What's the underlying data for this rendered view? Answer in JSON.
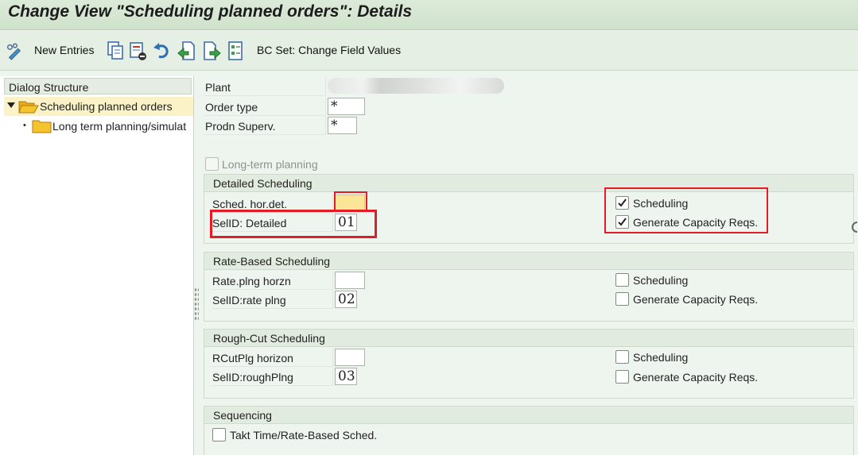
{
  "title": "Change View \"Scheduling planned orders\": Details",
  "toolbar": {
    "new_entries": "New Entries",
    "bc_set": "BC Set: Change Field Values"
  },
  "dialog_structure": {
    "title": "Dialog Structure",
    "items": [
      {
        "label": "Scheduling planned orders"
      },
      {
        "label": "Long term planning/simulat"
      }
    ]
  },
  "header_fields": {
    "plant_label": "Plant",
    "order_type_label": "Order type",
    "order_type_value": "*",
    "prodn_superv_label": "Prodn Superv.",
    "prodn_superv_value": "*"
  },
  "long_term_planning": {
    "label": "Long-term planning",
    "checked": false
  },
  "detailed": {
    "title": "Detailed Scheduling",
    "horizon_label": "Sched. hor.det.",
    "horizon_value": "",
    "selid_label": "SelID: Detailed",
    "selid_value": "01",
    "scheduling_label": "Scheduling",
    "scheduling_checked": true,
    "capacity_label": "Generate Capacity Reqs.",
    "capacity_checked": true
  },
  "rate": {
    "title": "Rate-Based Scheduling",
    "horizon_label": "Rate.plng horzn",
    "horizon_value": "",
    "selid_label": "SelID:rate plng",
    "selid_value": "02",
    "scheduling_label": "Scheduling",
    "scheduling_checked": false,
    "capacity_label": "Generate Capacity Reqs.",
    "capacity_checked": false
  },
  "rough": {
    "title": "Rough-Cut Scheduling",
    "horizon_label": "RCutPlg horizon",
    "horizon_value": "",
    "selid_label": "SelID:roughPlng",
    "selid_value": "03",
    "scheduling_label": "Scheduling",
    "scheduling_checked": false,
    "capacity_label": "Generate Capacity Reqs.",
    "capacity_checked": false
  },
  "sequencing": {
    "title": "Sequencing",
    "takt_label": "Takt Time/Rate-Based Sched.",
    "takt_checked": false
  },
  "colors": {
    "highlight": "#e31c26",
    "folder": "#f5c32c",
    "selected_row": "#fbf3c7",
    "required_field": "#fde597"
  }
}
